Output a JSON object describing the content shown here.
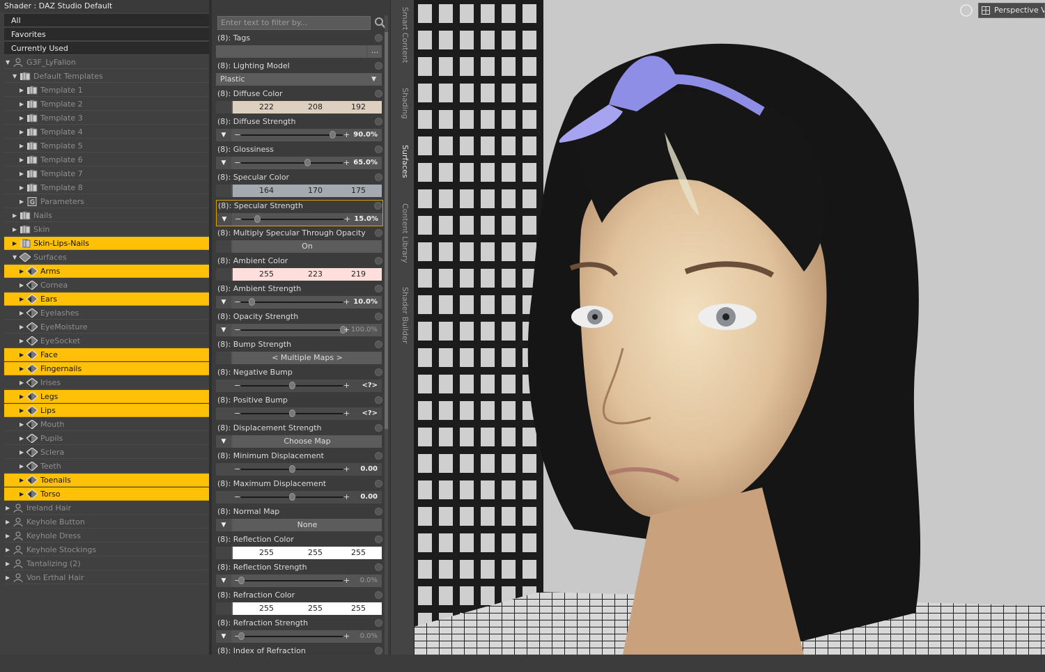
{
  "panel_title": "Shader : DAZ Studio Default",
  "filters": [
    "All",
    "Favorites",
    "Currently Used"
  ],
  "tree": [
    {
      "label": "G3F_LyFallon",
      "depth": 0,
      "arrow": "down",
      "icon": "figure-icon",
      "selected": false
    },
    {
      "label": "Default Templates",
      "depth": 1,
      "arrow": "down",
      "icon": "templates-folder-icon",
      "selected": false
    },
    {
      "label": "Template 1",
      "depth": 2,
      "arrow": "right",
      "icon": "template-icon",
      "selected": false
    },
    {
      "label": "Template 2",
      "depth": 2,
      "arrow": "right",
      "icon": "template-icon",
      "selected": false
    },
    {
      "label": "Template 3",
      "depth": 2,
      "arrow": "right",
      "icon": "template-icon",
      "selected": false
    },
    {
      "label": "Template 4",
      "depth": 2,
      "arrow": "right",
      "icon": "template-icon",
      "selected": false
    },
    {
      "label": "Template 5",
      "depth": 2,
      "arrow": "right",
      "icon": "template-icon",
      "selected": false
    },
    {
      "label": "Template 6",
      "depth": 2,
      "arrow": "right",
      "icon": "template-icon",
      "selected": false
    },
    {
      "label": "Template 7",
      "depth": 2,
      "arrow": "right",
      "icon": "template-icon",
      "selected": false
    },
    {
      "label": "Template 8",
      "depth": 2,
      "arrow": "right",
      "icon": "template-icon",
      "selected": false
    },
    {
      "label": "Parameters",
      "depth": 2,
      "arrow": "right",
      "icon": "parameters-icon",
      "selected": false
    },
    {
      "label": "Nails",
      "depth": 1,
      "arrow": "right",
      "icon": "templates-folder-icon",
      "selected": false
    },
    {
      "label": "Skin",
      "depth": 1,
      "arrow": "right",
      "icon": "templates-folder-icon",
      "selected": false
    },
    {
      "label": "Skin-Lips-Nails",
      "depth": 1,
      "arrow": "right",
      "icon": "templates-folder-icon",
      "selected": true
    },
    {
      "label": "Surfaces",
      "depth": 1,
      "arrow": "down",
      "icon": "surfaces-icon",
      "selected": false
    },
    {
      "label": "Arms",
      "depth": 2,
      "arrow": "right",
      "icon": "surface-icon",
      "selected": true
    },
    {
      "label": "Cornea",
      "depth": 2,
      "arrow": "right",
      "icon": "surface-icon",
      "selected": false
    },
    {
      "label": "Ears",
      "depth": 2,
      "arrow": "right",
      "icon": "surface-icon",
      "selected": true
    },
    {
      "label": "Eyelashes",
      "depth": 2,
      "arrow": "right",
      "icon": "surface-icon",
      "selected": false
    },
    {
      "label": "EyeMoisture",
      "depth": 2,
      "arrow": "right",
      "icon": "surface-icon",
      "selected": false
    },
    {
      "label": "EyeSocket",
      "depth": 2,
      "arrow": "right",
      "icon": "surface-icon",
      "selected": false
    },
    {
      "label": "Face",
      "depth": 2,
      "arrow": "right",
      "icon": "surface-icon",
      "selected": true
    },
    {
      "label": "Fingernails",
      "depth": 2,
      "arrow": "right",
      "icon": "surface-icon",
      "selected": true
    },
    {
      "label": "Irises",
      "depth": 2,
      "arrow": "right",
      "icon": "surface-icon",
      "selected": false
    },
    {
      "label": "Legs",
      "depth": 2,
      "arrow": "right",
      "icon": "surface-icon",
      "selected": true
    },
    {
      "label": "Lips",
      "depth": 2,
      "arrow": "right",
      "icon": "surface-icon",
      "selected": true
    },
    {
      "label": "Mouth",
      "depth": 2,
      "arrow": "right",
      "icon": "surface-icon",
      "selected": false
    },
    {
      "label": "Pupils",
      "depth": 2,
      "arrow": "right",
      "icon": "surface-icon",
      "selected": false
    },
    {
      "label": "Sclera",
      "depth": 2,
      "arrow": "right",
      "icon": "surface-icon",
      "selected": false
    },
    {
      "label": "Teeth",
      "depth": 2,
      "arrow": "right",
      "icon": "surface-icon",
      "selected": false
    },
    {
      "label": "Toenails",
      "depth": 2,
      "arrow": "right",
      "icon": "surface-icon",
      "selected": true
    },
    {
      "label": "Torso",
      "depth": 2,
      "arrow": "right",
      "icon": "surface-icon",
      "selected": true
    },
    {
      "label": "Ireland Hair",
      "depth": 0,
      "arrow": "right",
      "icon": "figure-icon",
      "selected": false
    },
    {
      "label": "Keyhole Button",
      "depth": 0,
      "arrow": "right",
      "icon": "figure-icon",
      "selected": false
    },
    {
      "label": "Keyhole Dress",
      "depth": 0,
      "arrow": "right",
      "icon": "figure-icon",
      "selected": false
    },
    {
      "label": "Keyhole Stockings",
      "depth": 0,
      "arrow": "right",
      "icon": "figure-icon",
      "selected": false
    },
    {
      "label": "Tantalizing (2)",
      "depth": 0,
      "arrow": "right",
      "icon": "figure-icon",
      "selected": false
    },
    {
      "label": "Von Erthal Hair",
      "depth": 0,
      "arrow": "right",
      "icon": "figure-icon",
      "selected": false
    }
  ],
  "filter_placeholder": "Enter text to filter by...",
  "properties": [
    {
      "name": "(8): Tags",
      "kind": "tags",
      "more": "..."
    },
    {
      "name": "(8): Lighting Model",
      "kind": "select",
      "value": "Plastic"
    },
    {
      "name": "(8): Diffuse Color",
      "kind": "color",
      "rgb": [
        "222",
        "208",
        "192"
      ],
      "swatch": "#ded0c0"
    },
    {
      "name": "(8): Diffuse Strength",
      "kind": "slider",
      "value": "90.0%",
      "fraction": 0.9,
      "dim": false
    },
    {
      "name": "(8): Glossiness",
      "kind": "slider",
      "value": "65.0%",
      "fraction": 0.65,
      "dim": false
    },
    {
      "name": "(8): Specular Color",
      "kind": "color",
      "rgb": [
        "164",
        "170",
        "175"
      ],
      "swatch": "#a4aaaf"
    },
    {
      "name": "(8): Specular Strength",
      "kind": "slider",
      "value": "15.0%",
      "fraction": 0.15,
      "dim": false,
      "highlighted": true
    },
    {
      "name": "(8): Multiply Specular Through Opacity",
      "kind": "button",
      "value": "On"
    },
    {
      "name": "(8): Ambient Color",
      "kind": "color",
      "rgb": [
        "255",
        "223",
        "219"
      ],
      "swatch": "#ffdfdb"
    },
    {
      "name": "(8): Ambient Strength",
      "kind": "slider",
      "value": "10.0%",
      "fraction": 0.1,
      "dim": false
    },
    {
      "name": "(8): Opacity Strength",
      "kind": "slider",
      "value": "100.0%",
      "fraction": 1.0,
      "dim": true
    },
    {
      "name": "(8): Bump Strength",
      "kind": "button",
      "value": "< Multiple Maps >"
    },
    {
      "name": "(8): Negative Bump",
      "kind": "slider",
      "value": "<?>",
      "fraction": 0.5,
      "dim": false,
      "noarrow": true
    },
    {
      "name": "(8): Positive Bump",
      "kind": "slider",
      "value": "<?>",
      "fraction": 0.5,
      "dim": false,
      "noarrow": true
    },
    {
      "name": "(8): Displacement Strength",
      "kind": "mapbutton",
      "value": "Choose Map"
    },
    {
      "name": "(8): Minimum Displacement",
      "kind": "slider",
      "value": "0.00",
      "fraction": 0.5,
      "dim": false,
      "noarrow": true
    },
    {
      "name": "(8): Maximum Displacement",
      "kind": "slider",
      "value": "0.00",
      "fraction": 0.5,
      "dim": false,
      "noarrow": true
    },
    {
      "name": "(8): Normal Map",
      "kind": "mapbutton",
      "value": "None"
    },
    {
      "name": "(8): Reflection Color",
      "kind": "color",
      "rgb": [
        "255",
        "255",
        "255"
      ],
      "swatch": "#ffffff"
    },
    {
      "name": "(8): Reflection Strength",
      "kind": "slider",
      "value": "0.0%",
      "fraction": 0.0,
      "dim": true
    },
    {
      "name": "(8): Refraction Color",
      "kind": "color",
      "rgb": [
        "255",
        "255",
        "255"
      ],
      "swatch": "#ffffff"
    },
    {
      "name": "(8): Refraction Strength",
      "kind": "slider",
      "value": "0.0%",
      "fraction": 0.0,
      "dim": true
    },
    {
      "name": "(8): Index of Refraction",
      "kind": "partial"
    }
  ],
  "side_tabs": [
    {
      "label": "Smart Content",
      "active": false
    },
    {
      "label": "Shading",
      "active": false
    },
    {
      "label": "Surfaces",
      "active": true
    },
    {
      "label": "Content Library",
      "active": false
    },
    {
      "label": "Shader Builder",
      "active": false
    }
  ],
  "viewport": {
    "camera_label": "Perspective View",
    "icon": "camera-icon"
  },
  "colors": {
    "selection": "#ffc107",
    "panel": "#404040",
    "viewport_bg": "#c9c9c9"
  }
}
